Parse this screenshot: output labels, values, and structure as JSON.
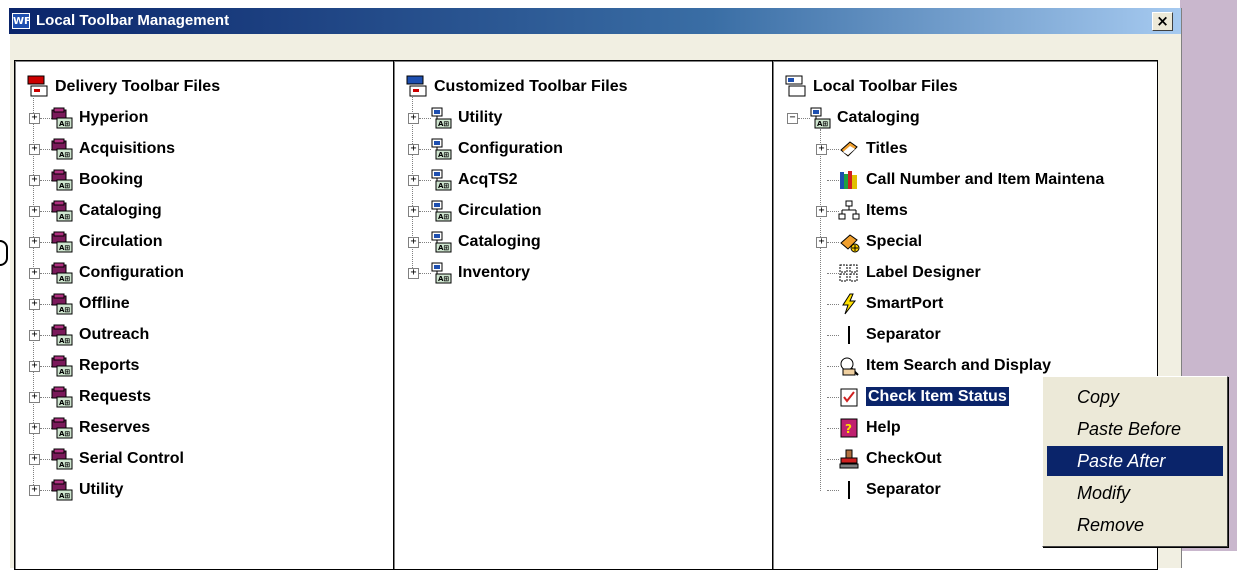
{
  "window": {
    "title": "Local Toolbar Management",
    "app_icon_text": "WF",
    "close_label": "×"
  },
  "panes": [
    {
      "title": "Delivery Toolbar Files",
      "items": [
        "Hyperion",
        "Acquisitions",
        "Booking",
        "Cataloging",
        "Circulation",
        "Configuration",
        "Offline",
        "Outreach",
        "Reports",
        "Requests",
        "Reserves",
        "Serial Control",
        "Utility"
      ]
    },
    {
      "title": "Customized Toolbar Files",
      "items": [
        "Utility",
        "Configuration",
        "AcqTS2",
        "Circulation",
        "Cataloging",
        "Inventory"
      ]
    },
    {
      "title": "Local Toolbar Files",
      "parent": "Cataloging",
      "items": [
        {
          "label": "Titles",
          "icon": "titles-icon",
          "expandable": true
        },
        {
          "label": "Call Number and Item Maintena",
          "icon": "books-icon",
          "expandable": false
        },
        {
          "label": "Items",
          "icon": "items-icon",
          "expandable": true
        },
        {
          "label": "Special",
          "icon": "special-icon",
          "expandable": true
        },
        {
          "label": "Label Designer",
          "icon": "label-designer-icon",
          "expandable": false
        },
        {
          "label": "SmartPort",
          "icon": "smartport-icon",
          "expandable": false
        },
        {
          "label": "Separator",
          "icon": "separator-icon",
          "expandable": false
        },
        {
          "label": "Item Search and Display",
          "icon": "item-search-icon",
          "expandable": false
        },
        {
          "label": "Check Item Status",
          "icon": "check-status-icon",
          "expandable": false,
          "selected": true
        },
        {
          "label": "Help",
          "icon": "help-icon",
          "expandable": false
        },
        {
          "label": "CheckOut",
          "icon": "checkout-icon",
          "expandable": false
        },
        {
          "label": "Separator",
          "icon": "separator-icon",
          "expandable": false
        }
      ]
    }
  ],
  "context_menu": {
    "items": [
      "Copy",
      "Paste Before",
      "Paste After",
      "Modify",
      "Remove"
    ],
    "highlighted": "Paste After"
  },
  "colors": {
    "selection": "#0a246a",
    "titlebar": "#0a246a",
    "window_bg": "#f1efe2"
  }
}
